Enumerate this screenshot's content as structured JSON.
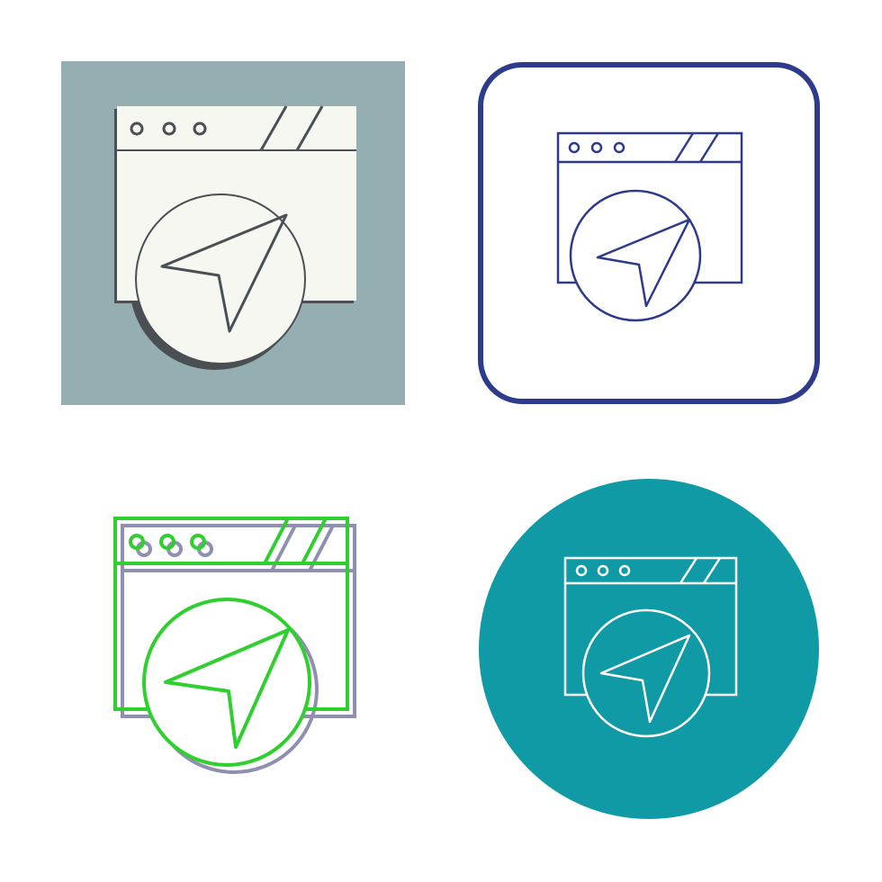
{
  "icon_set": {
    "subject": "browser-navigation-icon",
    "variants": [
      {
        "style": "glyph-with-shadow",
        "icon_name": "browser-navigation-icon",
        "colors": {
          "background": "#95aeb1",
          "fill": "#f6f7f1",
          "stroke": "#4a4f53"
        }
      },
      {
        "style": "line-in-rounded-square",
        "icon_name": "browser-navigation-icon",
        "colors": {
          "frame": "#2e3a8c",
          "stroke": "#2e3a8c",
          "background": "#ffffff"
        }
      },
      {
        "style": "two-tone-outline",
        "icon_name": "browser-navigation-icon",
        "colors": {
          "stroke": "#2ecf2e",
          "shadow": "#8f8fb0",
          "background": "#ffffff"
        }
      },
      {
        "style": "line-in-circle",
        "icon_name": "browser-navigation-icon",
        "colors": {
          "circle": "#0f9aa6",
          "stroke": "#ffffff"
        }
      }
    ]
  }
}
